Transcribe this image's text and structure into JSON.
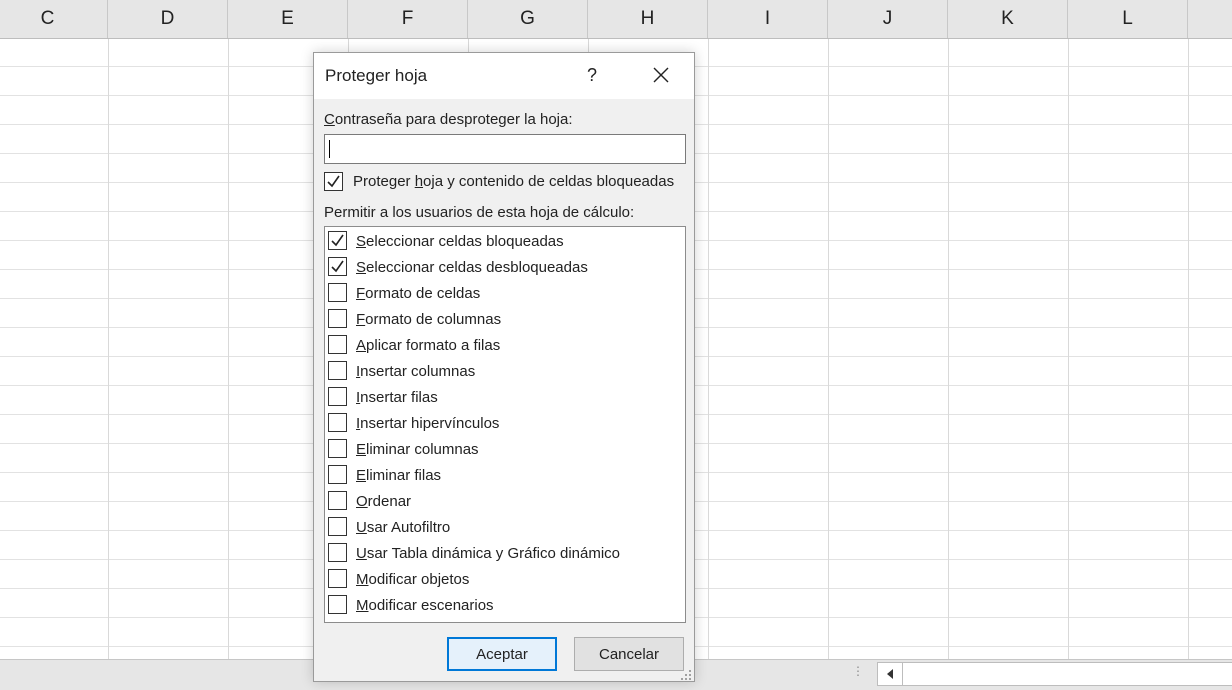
{
  "sheet": {
    "columns": [
      "C",
      "D",
      "E",
      "F",
      "G",
      "H",
      "I",
      "J",
      "K",
      "L"
    ]
  },
  "dialog": {
    "title": "Proteger hoja",
    "help_label": "?",
    "password_label_key": "C",
    "password_label_rest": "ontraseña para desproteger la hoja:",
    "password_value": "",
    "protect_label_before": "Proteger ",
    "protect_label_key": "h",
    "protect_label_after": "oja y contenido de celdas bloqueadas",
    "protect_checked": true,
    "permit_label": "Permitir a los usuarios de esta hoja de cálculo:",
    "permissions": [
      {
        "key": "S",
        "rest": "eleccionar celdas bloqueadas",
        "checked": true
      },
      {
        "key": "S",
        "rest": "eleccionar celdas desbloqueadas",
        "checked": true
      },
      {
        "key": "F",
        "rest": "ormato de celdas",
        "checked": false
      },
      {
        "key": "F",
        "rest": "ormato de columnas",
        "checked": false
      },
      {
        "key": "A",
        "rest": "plicar formato a filas",
        "checked": false
      },
      {
        "key": "I",
        "rest": "nsertar columnas",
        "checked": false
      },
      {
        "key": "I",
        "rest": "nsertar filas",
        "checked": false
      },
      {
        "key": "I",
        "rest": "nsertar hipervínculos",
        "checked": false
      },
      {
        "key": "E",
        "rest": "liminar columnas",
        "checked": false
      },
      {
        "key": "E",
        "rest": "liminar filas",
        "checked": false
      },
      {
        "key": "O",
        "rest": "rdenar",
        "checked": false
      },
      {
        "key": "U",
        "rest": "sar Autofiltro",
        "checked": false
      },
      {
        "key": "U",
        "rest": "sar Tabla dinámica y Gráfico dinámico",
        "checked": false
      },
      {
        "key": "M",
        "rest": "odificar objetos",
        "checked": false
      },
      {
        "key": "M",
        "rest": "odificar escenarios",
        "checked": false
      }
    ],
    "ok_label": "Aceptar",
    "cancel_label": "Cancelar"
  },
  "colors": {
    "accent": "#0078d7",
    "header_bg": "#e6e6e6",
    "dialog_bg": "#f0f0f0"
  }
}
